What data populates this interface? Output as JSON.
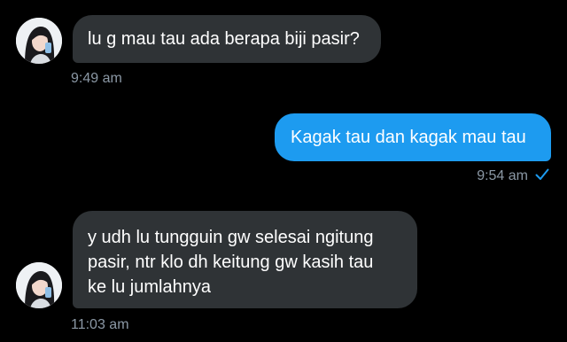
{
  "colors": {
    "background": "#000000",
    "incoming_bubble": "#2f3336",
    "outgoing_bubble": "#1d9bf0",
    "timestamp": "#8b98a5",
    "read_check": "#1d9bf0"
  },
  "messages": [
    {
      "direction": "incoming",
      "lines": [
        "lu g mau tau ada berapa biji pasir?"
      ],
      "time": "9:49 am",
      "avatar_icon": "user-avatar"
    },
    {
      "direction": "outgoing",
      "lines": [
        "Kagak tau dan kagak mau tau"
      ],
      "time": "9:54 am",
      "status_icon": "read-check-icon"
    },
    {
      "direction": "incoming",
      "lines": [
        "y udh lu tungguin gw selesai ngitung",
        "pasir, ntr klo dh keitung gw kasih tau",
        "ke lu jumlahnya"
      ],
      "time": "11:03 am",
      "avatar_icon": "user-avatar"
    }
  ]
}
